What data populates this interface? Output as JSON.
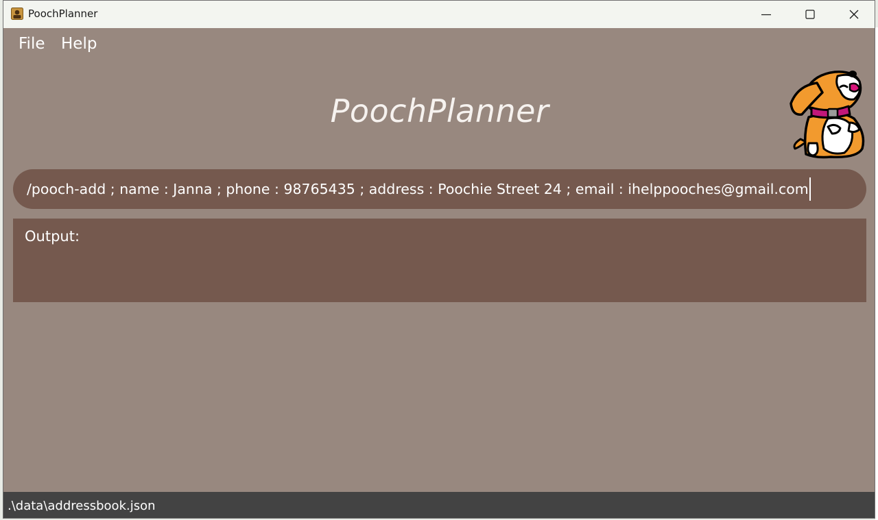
{
  "window": {
    "title": "PoochPlanner",
    "controls": {
      "minimize": "minimize-icon",
      "maximize": "maximize-icon",
      "close": "close-icon"
    }
  },
  "menu": {
    "file_label": "File",
    "help_label": "Help"
  },
  "header": {
    "app_title": "PoochPlanner",
    "mascot": "dog-mascot-icon"
  },
  "command": {
    "value": "/pooch-add ; name : Janna ; phone : 98765435 ; address : Poochie Street 24 ; email : ihelppooches@gmail.com"
  },
  "output": {
    "label": "Output:"
  },
  "status": {
    "file_path": ".\\data\\addressbook.json"
  },
  "colors": {
    "background": "#98887f",
    "panel": "#75594e",
    "status_bar": "#434343",
    "text": "#ffffff"
  }
}
